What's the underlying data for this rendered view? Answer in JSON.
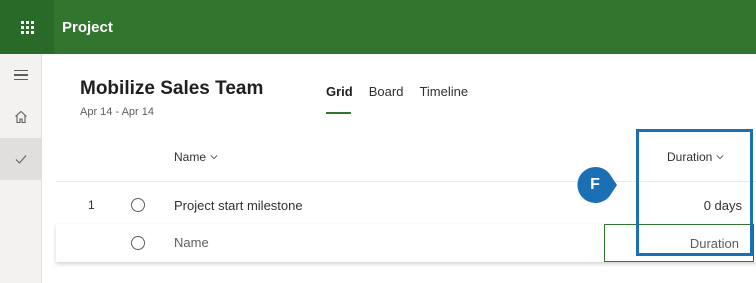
{
  "appbar": {
    "title": "Project",
    "color": "#31752f"
  },
  "rail": {
    "icons": [
      "hamburger-icon",
      "home-icon",
      "checkmark-icon"
    ]
  },
  "plan": {
    "title": "Mobilize Sales Team",
    "dates": "Apr 14 - Apr 14"
  },
  "tabs": [
    {
      "label": "Grid",
      "active": true
    },
    {
      "label": "Board",
      "active": false
    },
    {
      "label": "Timeline",
      "active": false
    }
  ],
  "columns": {
    "name": "Name",
    "duration": "Duration"
  },
  "tasks": [
    {
      "number": "1",
      "name": "Project start milestone",
      "duration": "0 days"
    }
  ],
  "new_row": {
    "name_placeholder": "Name",
    "duration_placeholder": "Duration"
  },
  "callout": {
    "letter": "F",
    "color": "#1b6fb5"
  }
}
